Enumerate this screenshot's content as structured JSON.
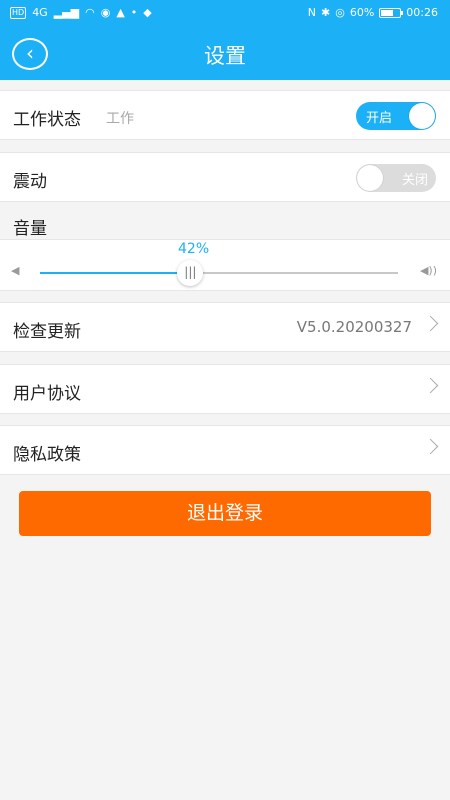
{
  "status_bar": {
    "hd": "HD",
    "net": "4G",
    "battery_pct": "60%",
    "time": "00:26"
  },
  "header": {
    "title": "设置",
    "back_icon": "chevron-left-icon"
  },
  "work_status": {
    "label": "工作状态",
    "value": "工作",
    "toggle_label": "开启",
    "on": true
  },
  "vibration": {
    "label": "震动",
    "toggle_label": "关闭",
    "on": false
  },
  "volume": {
    "title": "音量",
    "percent_text": "42%",
    "level": 0.42,
    "thumb_glyph": "|||"
  },
  "check_update": {
    "label": "检查更新",
    "version": "V5.0.20200327"
  },
  "user_agreement": {
    "label": "用户协议"
  },
  "privacy_policy": {
    "label": "隐私政策"
  },
  "logout": {
    "label": "退出登录"
  },
  "colors": {
    "primary": "#1cb0f6",
    "logout": "#ff6a00"
  }
}
